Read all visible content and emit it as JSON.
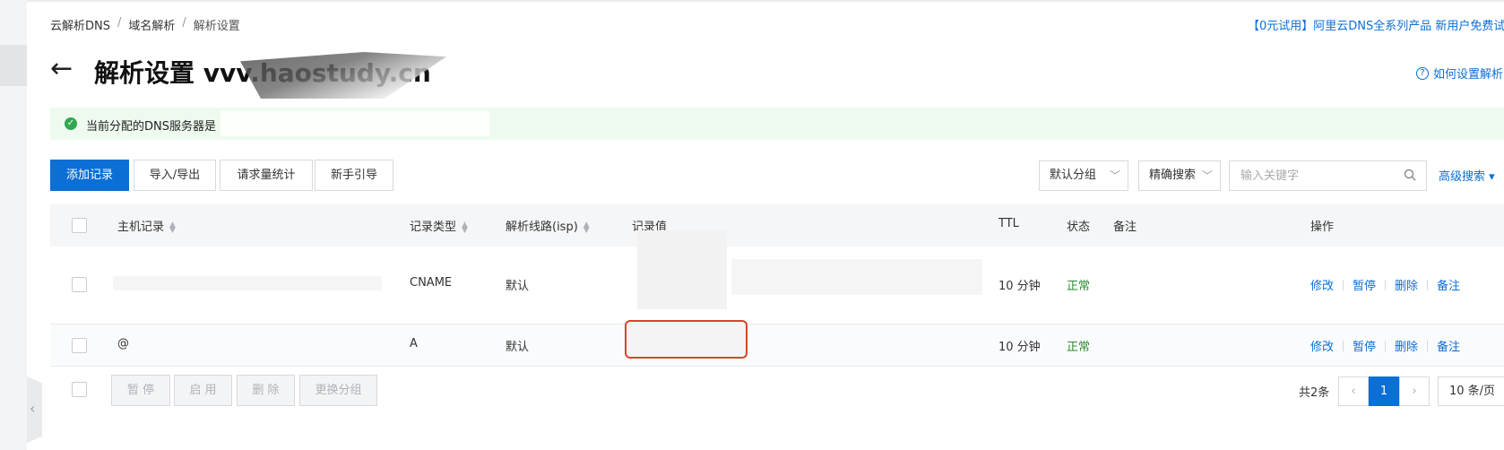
{
  "breadcrumb": {
    "items": [
      "云解析DNS",
      "域名解析",
      "解析设置"
    ],
    "separator": "/"
  },
  "promo_text": "【0元试用】阿里云DNS全系列产品 新用户免费试",
  "page": {
    "title": "解析设置 vvv.haostudy.cn",
    "help_link": "如何设置解析"
  },
  "alert": {
    "message": "当前分配的DNS服务器是"
  },
  "toolbar": {
    "add_record": "添加记录",
    "import_export": "导入/导出",
    "request_stats": "请求量统计",
    "beginner_guide": "新手引导",
    "group_select": "默认分组",
    "search_mode": "精确搜索",
    "search_placeholder": "输入关键字",
    "advanced_search": "高级搜索"
  },
  "table": {
    "headers": {
      "host": "主机记录",
      "type": "记录类型",
      "line": "解析线路(isp)",
      "value": "记录值",
      "ttl": "TTL",
      "status": "状态",
      "remark": "备注",
      "action": "操作"
    },
    "rows": [
      {
        "host": "",
        "type": "CNAME",
        "line": "默认",
        "value": "",
        "ttl": "10 分钟",
        "status": "正常",
        "actions": [
          "修改",
          "暂停",
          "删除",
          "备注"
        ]
      },
      {
        "host": "@",
        "type": "A",
        "line": "默认",
        "value": "",
        "ttl": "10 分钟",
        "status": "正常",
        "actions": [
          "修改",
          "暂停",
          "删除",
          "备注"
        ]
      }
    ]
  },
  "footer": {
    "bulk_actions": [
      "暂 停",
      "启 用",
      "删 除",
      "更换分组"
    ],
    "total": "共2条",
    "current_page": "1",
    "page_size": "10 条/页"
  },
  "colors": {
    "primary": "#0b6fd6",
    "success": "#2e8b31",
    "highlight_border": "#d9452c"
  }
}
